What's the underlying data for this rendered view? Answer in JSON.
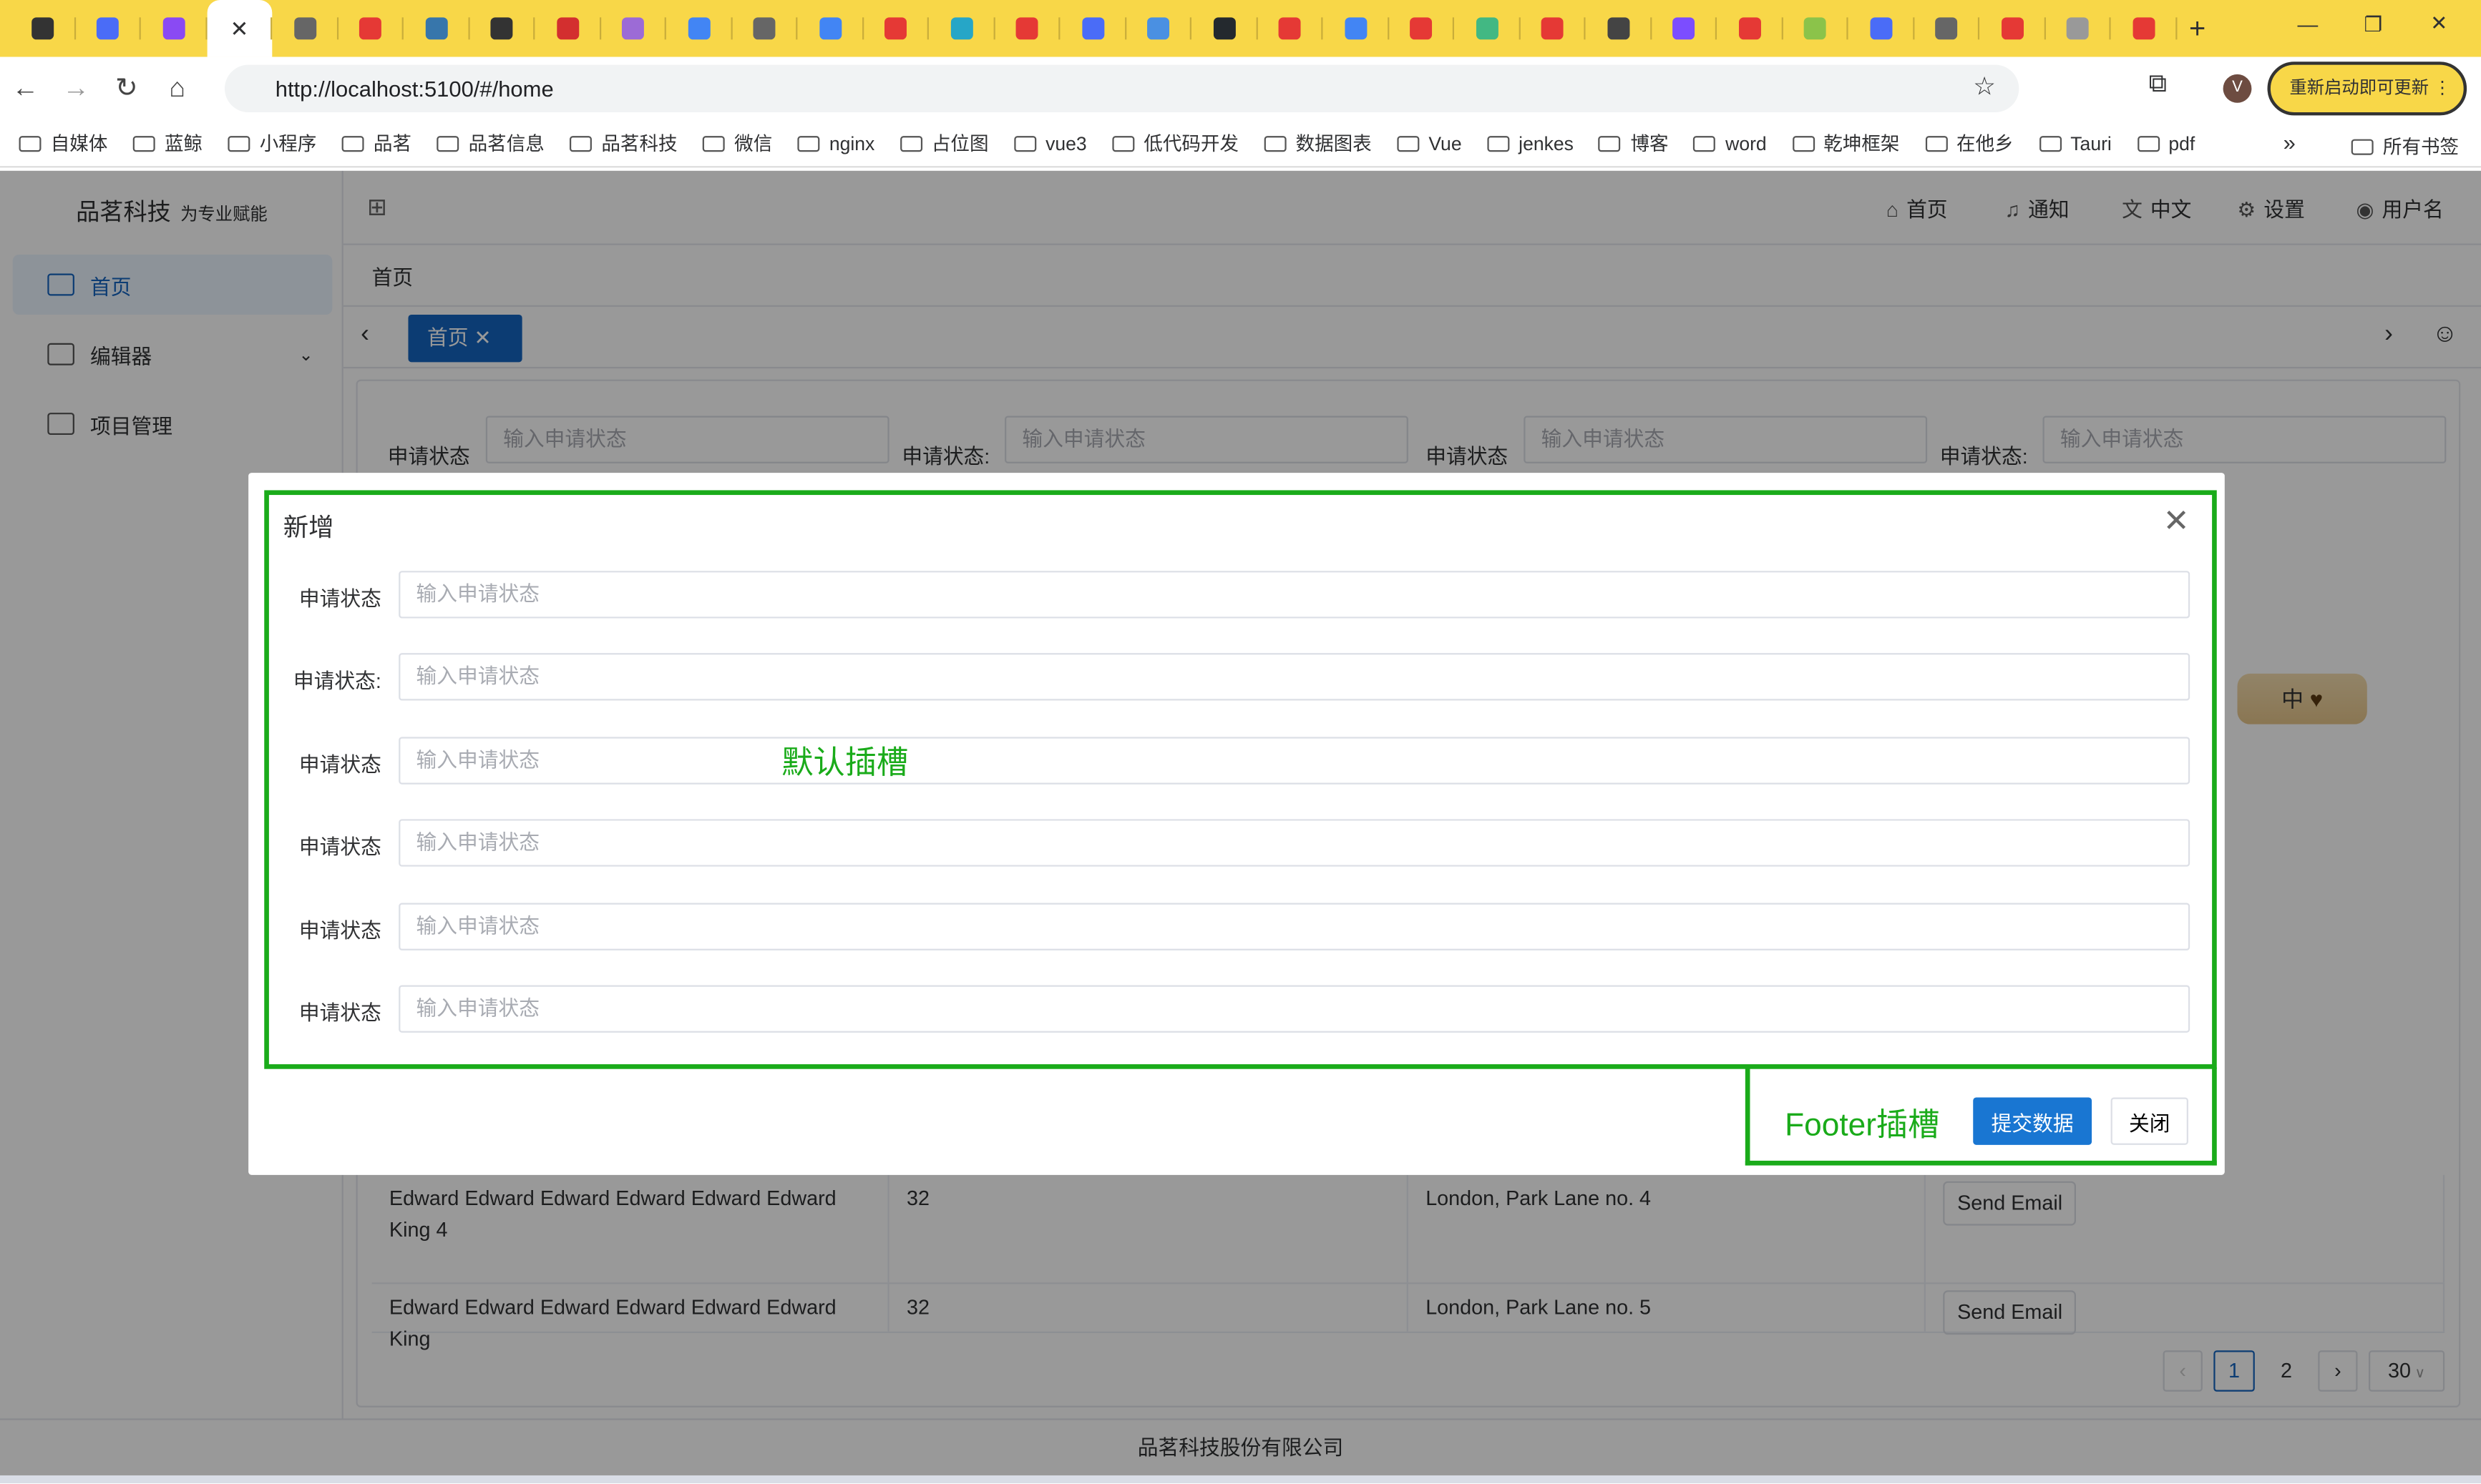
{
  "browser": {
    "tab_icons": [
      "chrome-menu-icon",
      "layers-icon",
      "vite-icon",
      "close-icon",
      "globe-icon",
      "red-circle-icon",
      "python-icon",
      "delta-icon",
      "fa-icon",
      "v-shield-icon",
      "google-icon",
      "y-icon",
      "google-icon",
      "c-red-icon",
      "wave-icon",
      "c-red-icon",
      "layers-icon",
      "diamond-icon",
      "github-icon",
      "c-red-icon",
      "google-icon",
      "red-box-icon",
      "vue-icon",
      "red-circle-icon",
      "mountain-icon",
      "pie-icon",
      "c-red-icon",
      "sprite-icon",
      "layers-icon",
      "globe-icon",
      "c-red-icon",
      "circle-icon",
      "target-icon"
    ],
    "tab_colors": [
      "#333333",
      "#4a6cf7",
      "#8a4af3",
      "#333333",
      "#666666",
      "#e53935",
      "#3776ab",
      "#333333",
      "#d32f2f",
      "#9c6bd6",
      "#4285f4",
      "#666666",
      "#4285f4",
      "#e53935",
      "#26a6c7",
      "#e53935",
      "#4a6cf7",
      "#4a90e2",
      "#24292e",
      "#e53935",
      "#4285f4",
      "#e53935",
      "#42b883",
      "#e53935",
      "#444444",
      "#7c4dff",
      "#e53935",
      "#8bc34a",
      "#4a6cf7",
      "#666666",
      "#e53935",
      "#999999",
      "#e53935"
    ],
    "url": "http://localhost:5100/#/home",
    "update_label": "重新启动即可更新",
    "bookmarks": [
      "自媒体",
      "蓝鲸",
      "小程序",
      "品茗",
      "品茗信息",
      "品茗科技",
      "微信",
      "nginx",
      "占位图",
      "vue3",
      "低代码开发",
      "数据图表",
      "Vue",
      "jenkes",
      "博客",
      "word",
      "乾坤框架",
      "在他乡",
      "Tauri",
      "pdf"
    ],
    "bookmarks_more": "»",
    "all_bookmarks": "所有书签"
  },
  "app": {
    "logo": "品茗科技",
    "logo_sub": "为专业赋能",
    "sidebar": [
      {
        "label": "首页",
        "active": true
      },
      {
        "label": "编辑器",
        "expandable": true
      },
      {
        "label": "项目管理"
      }
    ],
    "header_nav": [
      {
        "icon": "home-icon",
        "label": "首页"
      },
      {
        "icon": "bell-icon",
        "label": "通知"
      },
      {
        "icon": "translate-icon",
        "label": "中文"
      },
      {
        "icon": "gear-icon",
        "label": "设置"
      },
      {
        "icon": "user-icon",
        "label": "用户名"
      }
    ],
    "breadcrumb": "首页",
    "open_tab": "首页",
    "search": [
      {
        "label": "申请状态",
        "placeholder": "输入申请状态"
      },
      {
        "label": "申请状态:",
        "placeholder": "输入申请状态"
      },
      {
        "label": "申请状态",
        "placeholder": "输入申请状态"
      },
      {
        "label": "申请状态:",
        "placeholder": "输入申请状态"
      }
    ],
    "table_rows": [
      {
        "name": "Edward Edward Edward Edward Edward Edward King 4",
        "age": "32",
        "address": "London, Park Lane no. 4",
        "action": "Send Email"
      },
      {
        "name": "Edward Edward Edward Edward Edward Edward King",
        "age": "32",
        "address": "London, Park Lane no. 5",
        "action": "Send Email"
      }
    ],
    "pagination": {
      "pages": [
        "1",
        "2"
      ],
      "current": "1",
      "page_size": "30"
    },
    "footer": "品茗科技股份有限公司",
    "ime_tag": "中"
  },
  "modal": {
    "title": "新增",
    "fields": [
      {
        "label": "申请状态",
        "placeholder": "输入申请状态"
      },
      {
        "label": "申请状态:",
        "placeholder": "输入申请状态"
      },
      {
        "label": "申请状态",
        "placeholder": "输入申请状态"
      },
      {
        "label": "申请状态",
        "placeholder": "输入申请状态"
      },
      {
        "label": "申请状态",
        "placeholder": "输入申请状态"
      },
      {
        "label": "申请状态",
        "placeholder": "输入申请状态"
      }
    ],
    "default_slot": "默认插槽",
    "footer_slot": "Footer插槽",
    "submit_label": "提交数据",
    "close_label": "关闭",
    "slot_color": "#1aab1a",
    "primary_color": "#1976d2"
  }
}
